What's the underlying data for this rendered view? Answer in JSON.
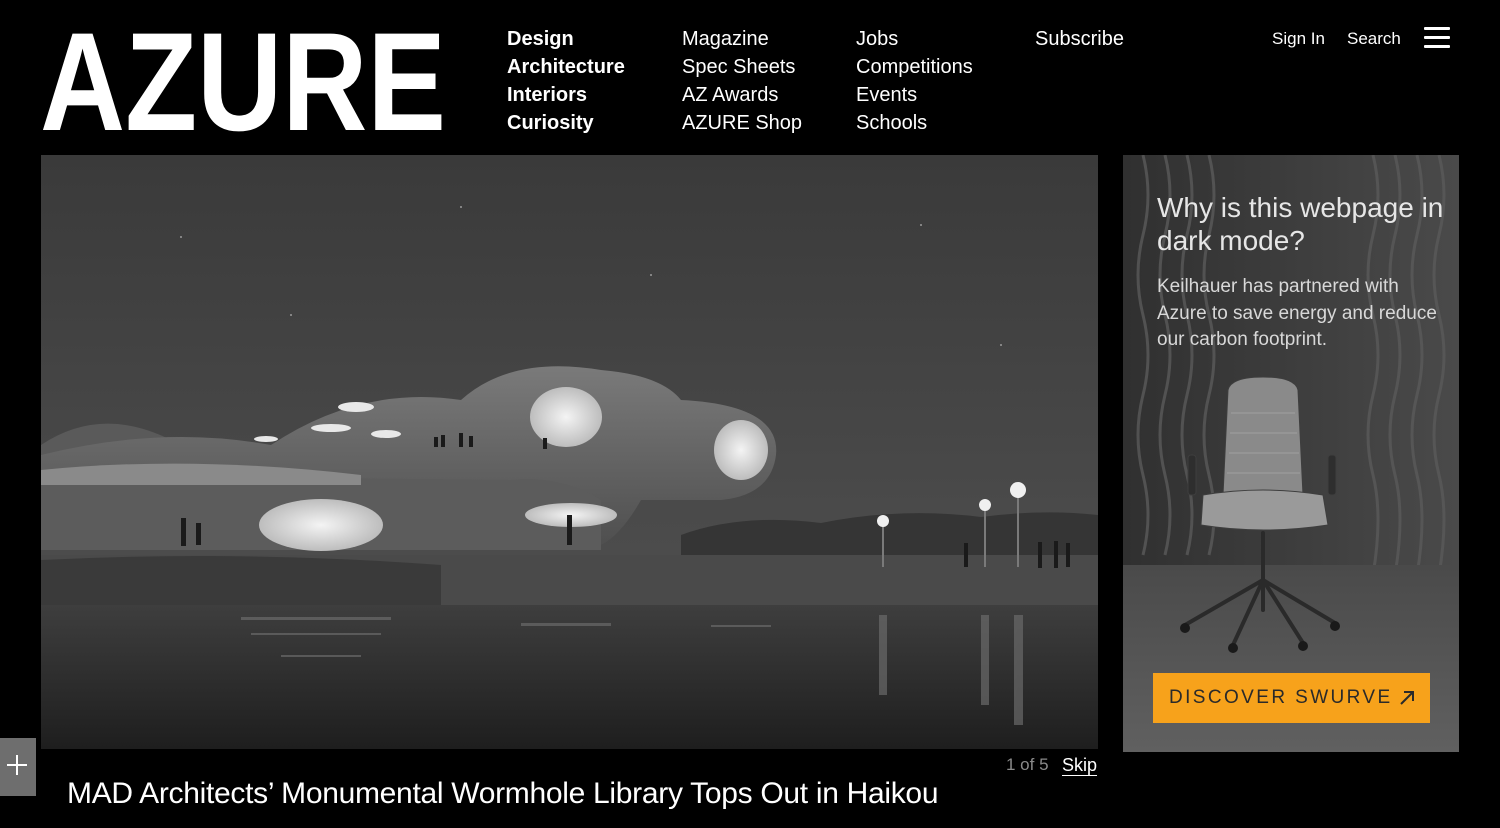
{
  "brand": {
    "logo_text": "AZURE"
  },
  "nav": {
    "primary": [
      "Design",
      "Architecture",
      "Interiors",
      "Curiosity"
    ],
    "secondary": [
      "Magazine",
      "Spec Sheets",
      "AZ Awards",
      "AZURE Shop"
    ],
    "tertiary": [
      "Jobs",
      "Competitions",
      "Events",
      "Schools"
    ],
    "subscribe": "Subscribe"
  },
  "utility": {
    "sign_in": "Sign In",
    "search": "Search",
    "menu_icon": "hamburger-icon"
  },
  "hero": {
    "slide_counter": "1 of 5",
    "skip": "Skip"
  },
  "headline": "MAD Architects’ Monumental Wormhole Library Tops Out in Haikou",
  "ad": {
    "title": "Why is this webpage in dark mode?",
    "body": "Keilhauer has partnered with Azure to save energy and reduce our carbon footprint.",
    "cta": "DISCOVER SWURVE",
    "cta_icon": "arrow-up-right-icon",
    "cta_color": "#f7a21b"
  },
  "expand_icon": "plus-icon"
}
